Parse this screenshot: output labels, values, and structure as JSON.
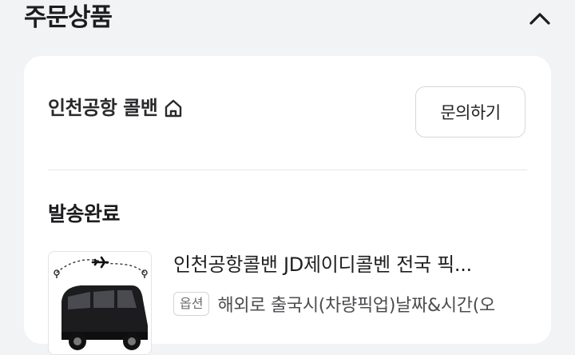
{
  "section": {
    "title": "주문상품"
  },
  "store": {
    "name": "인천공항 콜밴",
    "inquiry_label": "문의하기"
  },
  "order": {
    "status": "발송완료",
    "product_title": "인천공항콜밴 JD제이디콜벤 전국 픽...",
    "option_badge": "옵션",
    "option_text": "해외로 출국시(차량픽업)날짜&시간(오"
  },
  "icons": {
    "collapse": "chevron-up-icon",
    "store_home": "home-icon"
  }
}
